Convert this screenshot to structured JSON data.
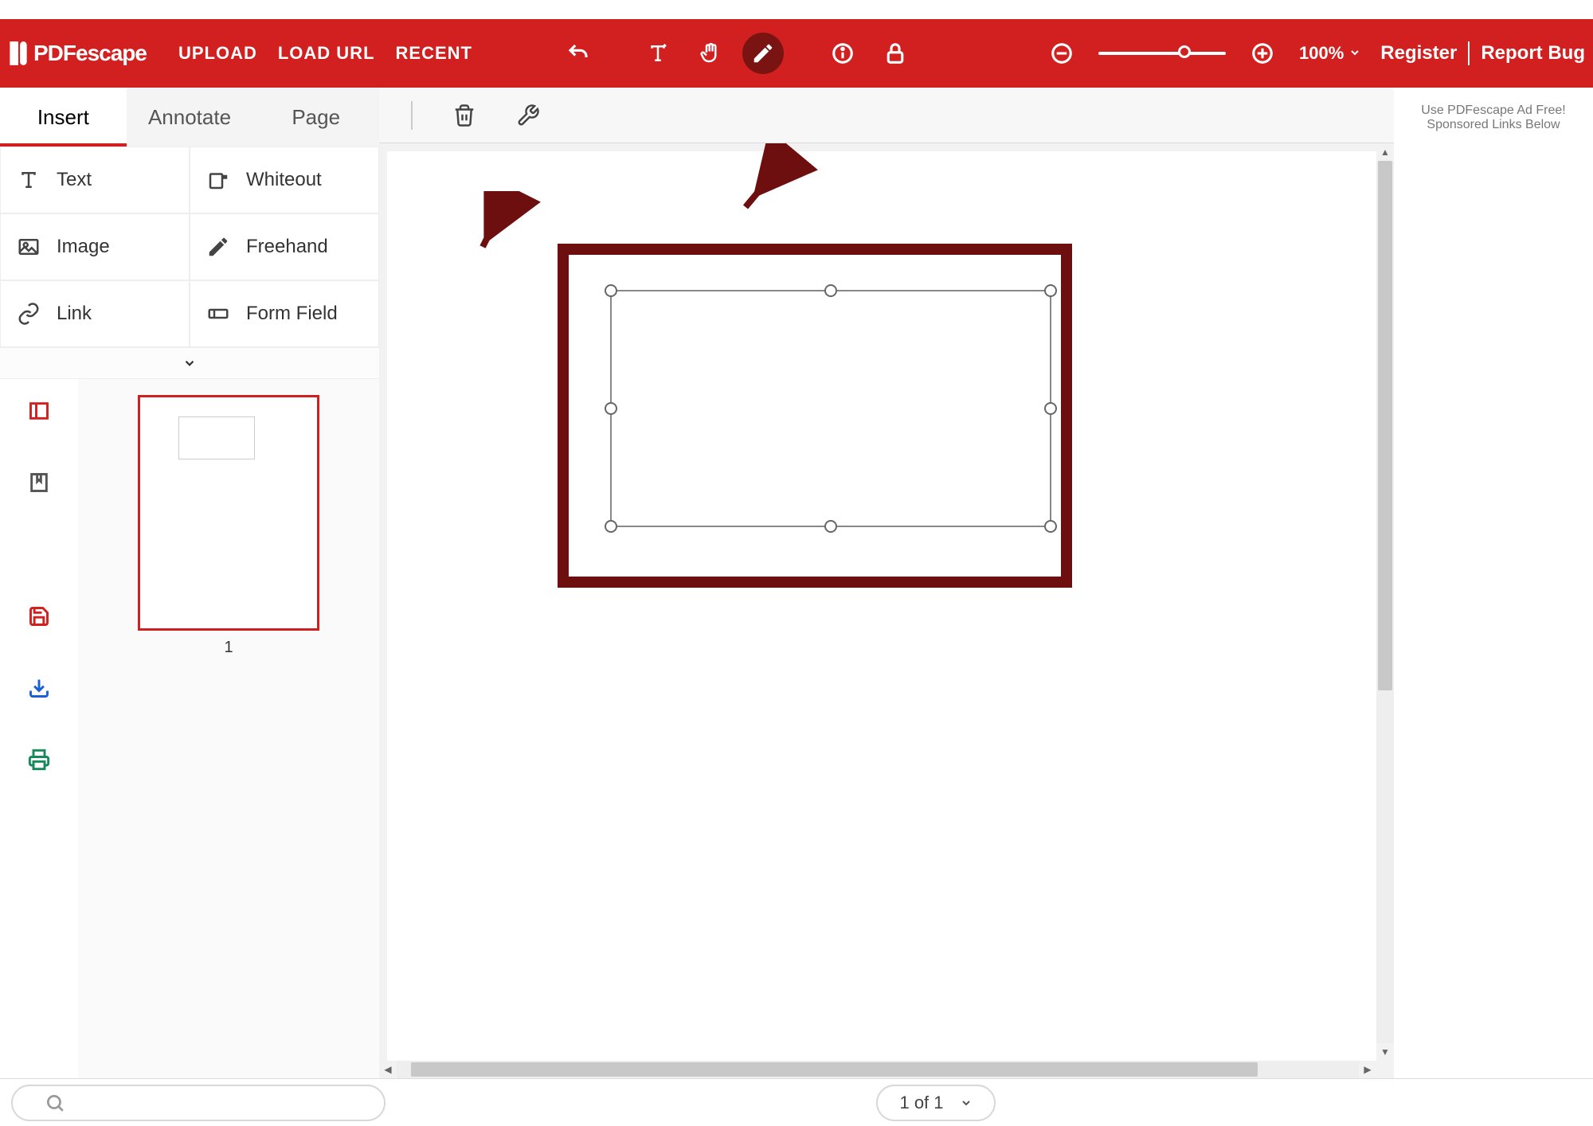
{
  "app": {
    "name": "PDFescape"
  },
  "nav": {
    "upload": "UPLOAD",
    "load_url": "LOAD URL",
    "recent": "RECENT"
  },
  "header": {
    "zoom_label": "100%",
    "register": "Register",
    "report_bug": "Report Bug"
  },
  "tabs": {
    "insert": "Insert",
    "annotate": "Annotate",
    "page": "Page",
    "active": "insert"
  },
  "tools": {
    "text": "Text",
    "whiteout": "Whiteout",
    "image": "Image",
    "freehand": "Freehand",
    "link": "Link",
    "form_field": "Form Field"
  },
  "thumbnails": {
    "page1_label": "1"
  },
  "ad": {
    "line1": "Use PDFescape Ad Free!",
    "line2": "Sponsored Links Below"
  },
  "footer": {
    "page_indicator": "1 of 1"
  },
  "colors": {
    "accent": "#d1201f",
    "highlight_box": "#6e0f0f"
  }
}
